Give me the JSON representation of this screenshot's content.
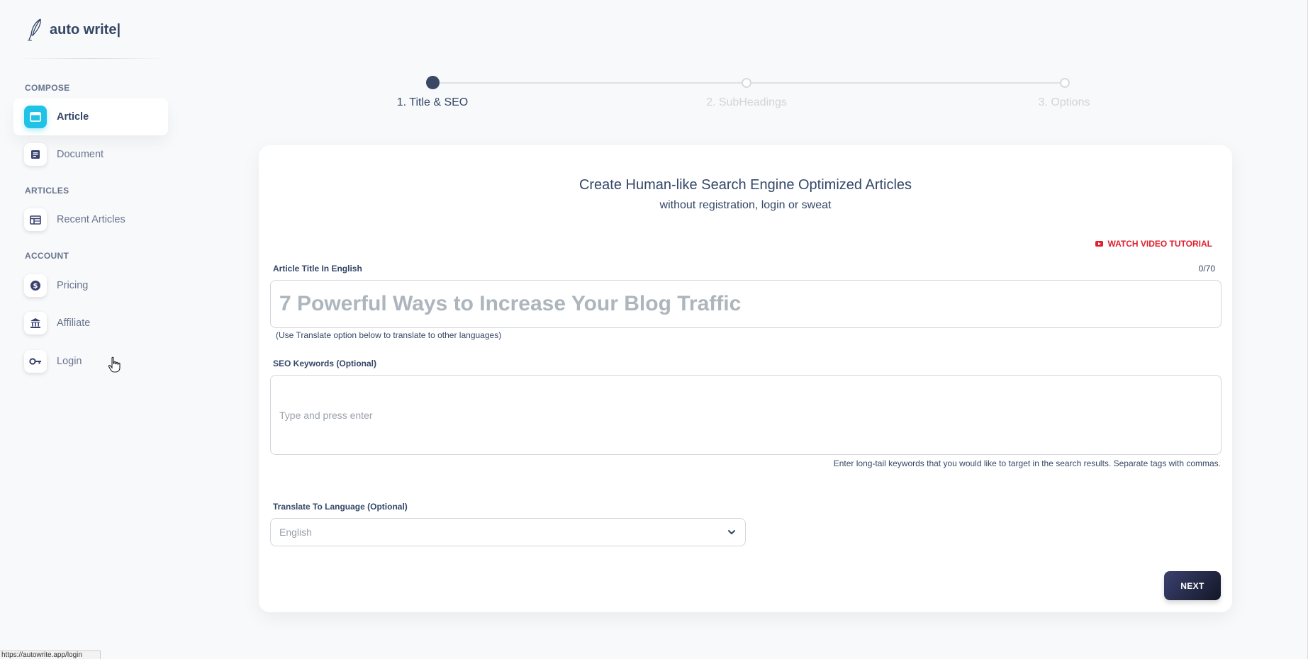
{
  "brand": {
    "name": "auto write|"
  },
  "sidebar": {
    "sections": [
      {
        "label": "COMPOSE"
      },
      {
        "label": "ARTICLES"
      },
      {
        "label": "ACCOUNT"
      }
    ],
    "items": [
      {
        "label": "Article",
        "icon": "browser-window-icon",
        "active": true
      },
      {
        "label": "Document",
        "icon": "document-icon",
        "active": false
      },
      {
        "label": "Recent Articles",
        "icon": "table-layout-icon",
        "active": false
      },
      {
        "label": "Pricing",
        "icon": "dollar-coin-icon",
        "active": false
      },
      {
        "label": "Affiliate",
        "icon": "bank-icon",
        "active": false
      },
      {
        "label": "Login",
        "icon": "key-icon",
        "active": false
      }
    ]
  },
  "stepper": {
    "steps": [
      {
        "label": "1. Title & SEO",
        "active": true
      },
      {
        "label": "2. SubHeadings",
        "active": false
      },
      {
        "label": "3. Options",
        "active": false
      }
    ]
  },
  "form": {
    "title": "Create Human-like Search Engine Optimized Articles",
    "subtitle": "without registration, login or sweat",
    "tutorial_label": "WATCH VIDEO TUTORIAL",
    "article_title_label": "Article Title In English",
    "article_title_counter": "0/70",
    "article_title_placeholder": "7 Powerful Ways to Increase Your Blog Traffic",
    "article_title_value": "",
    "article_title_hint": "(Use Translate option below to translate to other languages)",
    "keywords_label": "SEO Keywords (Optional)",
    "keywords_placeholder": "Type and press enter",
    "keywords_help": "Enter long-tail keywords that you would like to target in the search results. Separate tags with commas.",
    "language_label": "Translate To Language (Optional)",
    "language_selected": "English",
    "next_label": "NEXT"
  },
  "status_bar": {
    "url": "https://autowrite.app/login"
  },
  "colors": {
    "accent": "#20c2e6",
    "primary_dark": "#344767",
    "tutorial_red": "#e01e2d",
    "button_dark": "#141727"
  }
}
